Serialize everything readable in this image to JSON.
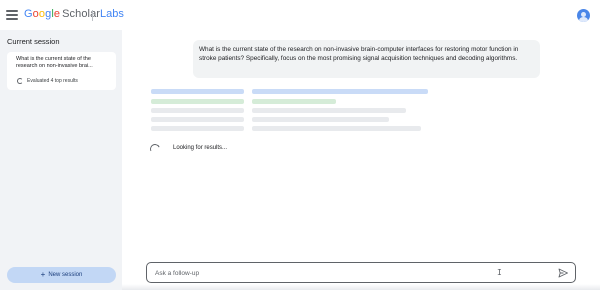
{
  "header": {
    "logo_letters": [
      "G",
      "o",
      "o",
      "g",
      "l",
      "e"
    ],
    "logo_product": "Scholar",
    "labs_label": "Labs",
    "icons": {
      "menu": "hamburger-menu-icon",
      "account": "account-avatar-icon"
    }
  },
  "sidebar": {
    "title": "Current session",
    "session": {
      "text": "What is the current state of the research on non-invasive brai...",
      "status": "Evaluated 4 top results"
    },
    "new_session_label": "New session"
  },
  "main": {
    "query": "What is the current state of the research on non-invasive brain-computer interfaces for restoring motor function in stroke patients? Specifically, focus on the most promising signal acquisition techniques and decoding algorithms.",
    "loading_text": "Looking for results..."
  },
  "followup": {
    "placeholder": "Ask a follow-up",
    "value": ""
  },
  "colors": {
    "accent": "#4285f4",
    "sidebar_bg": "#f1f3f6",
    "new_session_bg": "#c2d7f5",
    "skeleton_blue": "#c9dbf7",
    "skeleton_green": "#d5ecd8",
    "skeleton_gray": "#e8eaed"
  }
}
